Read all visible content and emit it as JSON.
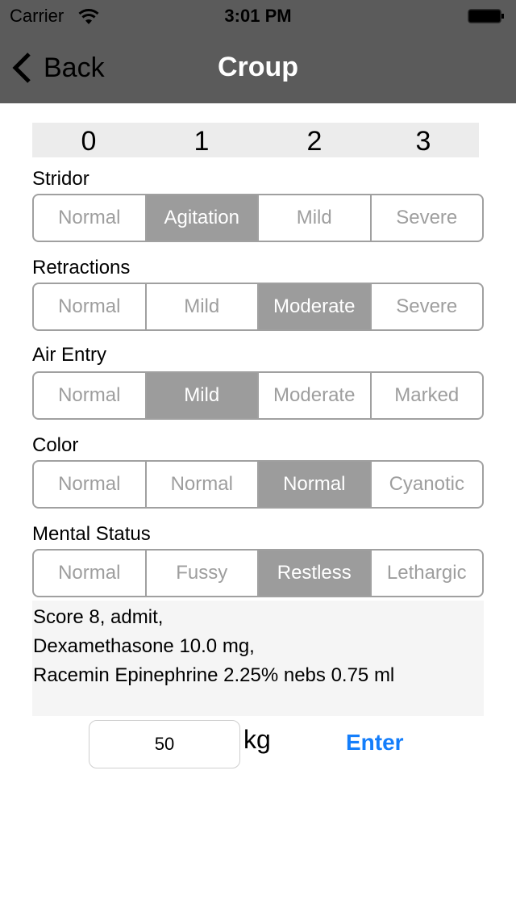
{
  "status_bar": {
    "carrier": "Carrier",
    "time": "3:01 PM",
    "wifi_icon": "wifi-icon",
    "battery_icon": "battery-icon"
  },
  "nav": {
    "back_label": "Back",
    "back_icon": "chevron-left-icon",
    "title": "Croup"
  },
  "scale": [
    "0",
    "1",
    "2",
    "3"
  ],
  "criteria": [
    {
      "label": "Stridor",
      "options": [
        "Normal",
        "Agitation",
        "Mild",
        "Severe"
      ],
      "selected": 1
    },
    {
      "label": "Retractions",
      "options": [
        "Normal",
        "Mild",
        "Moderate",
        "Severe"
      ],
      "selected": 2
    },
    {
      "label": "Air Entry",
      "options": [
        "Normal",
        "Mild",
        "Moderate",
        "Marked"
      ],
      "selected": 1
    },
    {
      "label": "Color",
      "options": [
        "Normal",
        "Normal",
        "Normal",
        "Cyanotic"
      ],
      "selected": 2
    },
    {
      "label": "Mental Status",
      "options": [
        "Normal",
        "Fussy",
        "Restless",
        "Lethargic"
      ],
      "selected": 2
    }
  ],
  "result": {
    "lines": [
      "Score 8, admit,",
      "Dexamethasone 10.0 mg,",
      "Racemin Epinephrine 2.25% nebs 0.75 ml"
    ]
  },
  "weight": {
    "value": "50",
    "unit": "kg",
    "enter_label": "Enter"
  },
  "colors": {
    "navbar": "#5b5b5b",
    "selected_segment": "#9c9c9c",
    "accent": "#147efb"
  }
}
